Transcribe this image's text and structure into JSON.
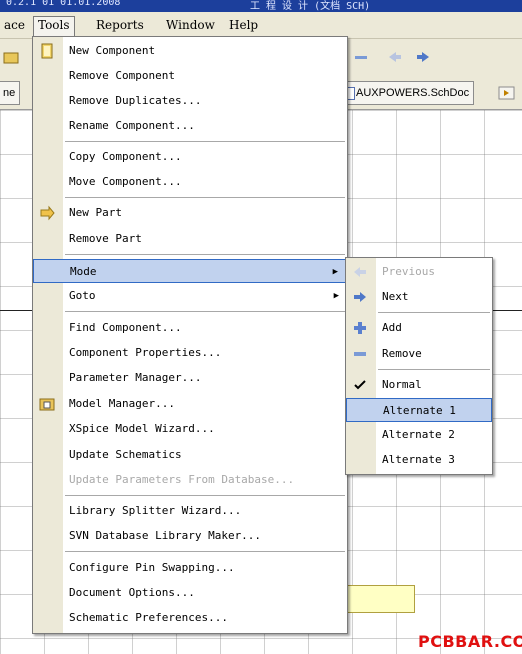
{
  "title_bar": {
    "left_text": "0.2.1 01 01.01.2008",
    "right_text": "工 程 设 计 (文档 SCH)"
  },
  "menubar": {
    "items": [
      {
        "label": "ace"
      },
      {
        "label": "Tools"
      },
      {
        "label": "Reports"
      },
      {
        "label": "Window"
      },
      {
        "label": "Help"
      }
    ]
  },
  "tabs": {
    "left_stub": "ne",
    "document": "AUXPOWERS.SchDoc"
  },
  "tools_menu": {
    "items": [
      {
        "label": "New Component",
        "icon": "new-component-icon"
      },
      {
        "label": "Remove Component"
      },
      {
        "label": "Remove Duplicates..."
      },
      {
        "label": "Rename Component..."
      },
      {
        "label": "Copy Component..."
      },
      {
        "label": "Move Component..."
      },
      {
        "label": "New Part",
        "icon": "new-part-icon"
      },
      {
        "label": "Remove Part"
      },
      {
        "label": "Mode",
        "submenu": true,
        "state": "highlighted"
      },
      {
        "label": "Goto",
        "submenu": true
      },
      {
        "label": "Find Component..."
      },
      {
        "label": "Component Properties..."
      },
      {
        "label": "Parameter Manager..."
      },
      {
        "label": "Model Manager...",
        "icon": "model-manager-icon"
      },
      {
        "label": "XSpice Model Wizard..."
      },
      {
        "label": "Update Schematics"
      },
      {
        "label": "Update Parameters From Database...",
        "state": "disabled"
      },
      {
        "label": "Library Splitter Wizard..."
      },
      {
        "label": "SVN Database Library Maker..."
      },
      {
        "label": "Configure Pin Swapping..."
      },
      {
        "label": "Document Options..."
      },
      {
        "label": "Schematic Preferences..."
      }
    ]
  },
  "mode_submenu": {
    "items": [
      {
        "label": "Previous",
        "icon": "arrow-left-icon",
        "state": "disabled"
      },
      {
        "label": "Next",
        "icon": "arrow-right-icon"
      },
      {
        "label": "Add",
        "icon": "plus-icon"
      },
      {
        "label": "Remove",
        "icon": "minus-icon"
      },
      {
        "label": "Normal",
        "icon": "checkmark-icon",
        "state": "checked"
      },
      {
        "label": "Alternate 1",
        "state": "highlighted"
      },
      {
        "label": "Alternate 2"
      },
      {
        "label": "Alternate 3"
      }
    ]
  },
  "watermark": "PCBBAR.COM",
  "colors": {
    "title_bar": "#1c3f9c",
    "highlight": "#c1d2ee",
    "highlight_border": "#316ac5",
    "watermark": "#e01010"
  }
}
